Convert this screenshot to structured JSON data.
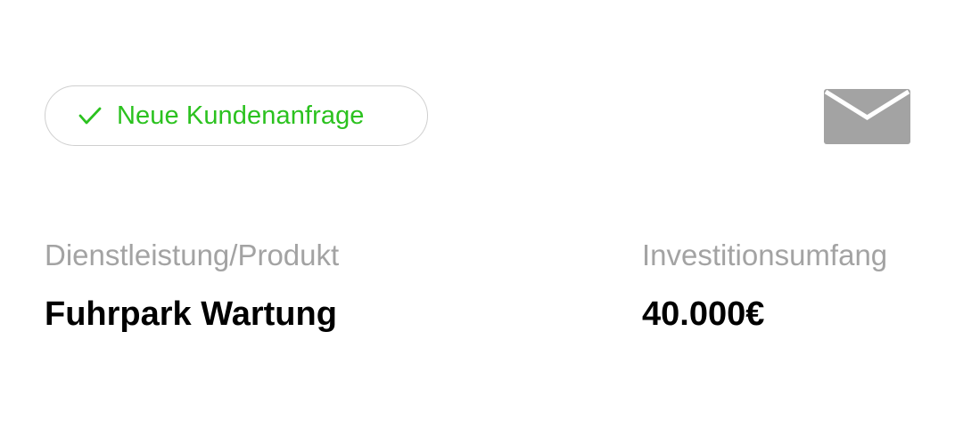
{
  "status": {
    "label": "Neue Kundenanfrage",
    "icon": "check-icon",
    "color": "#2bc21f"
  },
  "mail": {
    "icon": "envelope-icon",
    "color": "#a3a3a3"
  },
  "fields": {
    "service": {
      "label": "Dienstleistung/Produkt",
      "value": "Fuhrpark Wartung"
    },
    "investment": {
      "label": "Investitionsumfang",
      "value": "40.000€"
    }
  }
}
